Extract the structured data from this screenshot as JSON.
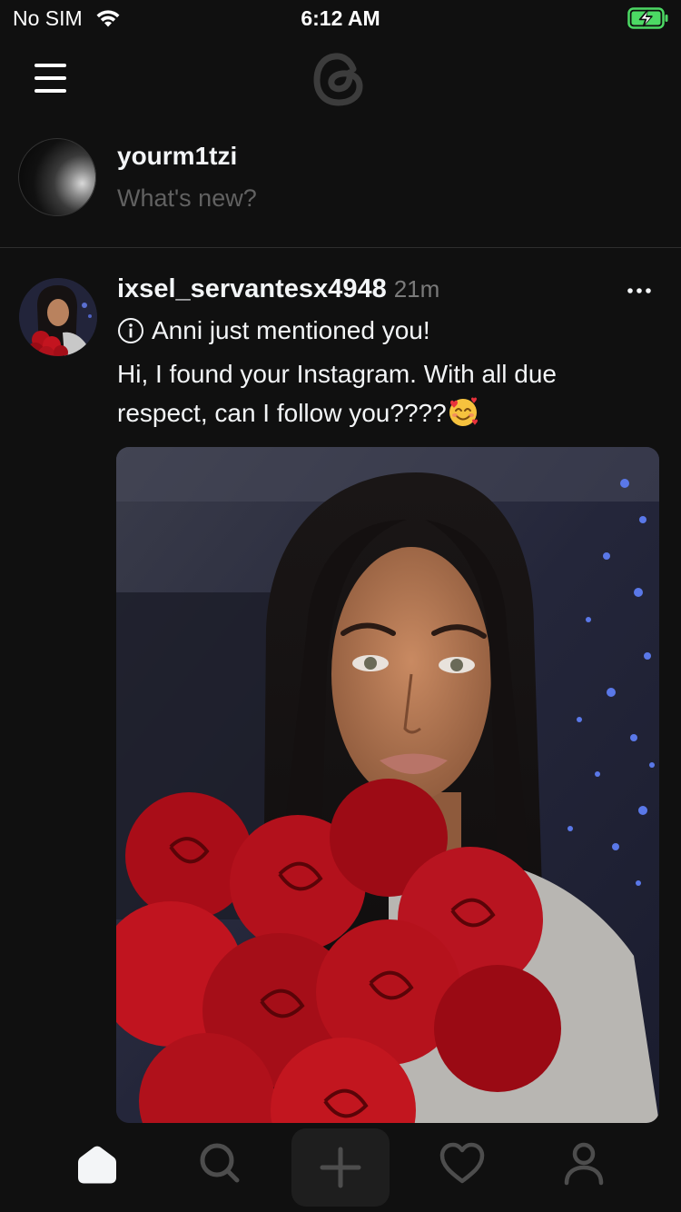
{
  "status_bar": {
    "carrier": "No SIM",
    "time": "6:12 AM",
    "wifi_icon": "wifi-icon",
    "battery_icon": "battery-charging-icon",
    "battery_color": "#4cd964"
  },
  "header": {
    "menu_icon": "hamburger-menu-icon",
    "logo_icon": "threads-logo-icon"
  },
  "composer": {
    "username": "yourm1tzi",
    "placeholder": "What's new?"
  },
  "post": {
    "username": "ixsel_servantesx4948",
    "time": "21m",
    "more_icon": "more-horizontal-icon",
    "info_icon": "info-icon",
    "info_text": "Anni just mentioned you!",
    "body_text": "Hi, I found your Instagram. With all due respect, can I follow you????",
    "emoji": "smiling-face-with-hearts-emoji",
    "image_description_icon": "post-photo"
  },
  "tab_bar": {
    "items": [
      {
        "icon": "home-icon",
        "active": true
      },
      {
        "icon": "search-icon",
        "active": false
      },
      {
        "icon": "plus-icon",
        "active": false
      },
      {
        "icon": "heart-icon",
        "active": false
      },
      {
        "icon": "profile-icon",
        "active": false
      }
    ]
  },
  "colors": {
    "background": "#101010",
    "text_primary": "#f3f5f7",
    "text_secondary": "#616161",
    "divider": "#2e2e2e",
    "inactive_icon": "#4d4d4d"
  }
}
